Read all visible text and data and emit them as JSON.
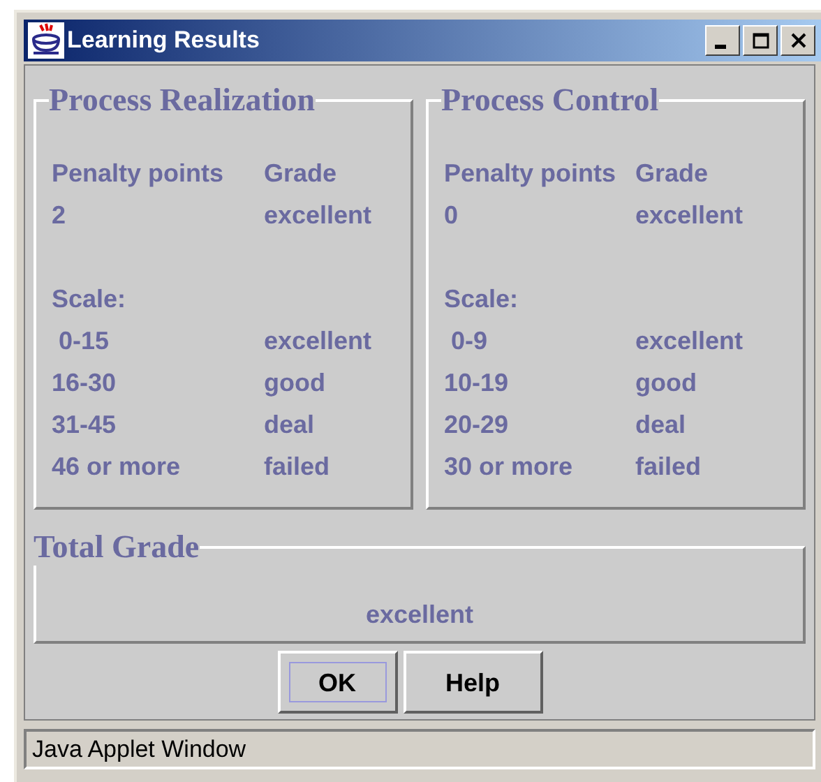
{
  "window": {
    "title": "Learning Results"
  },
  "panels": [
    {
      "title": "Process Realization",
      "header": [
        "Penalty points",
        "Grade"
      ],
      "result": [
        "2",
        "excellent"
      ],
      "scale_label": "Scale:",
      "scale": [
        {
          "range": " 0-15",
          "grade": "excellent"
        },
        {
          "range": "16-30",
          "grade": "good"
        },
        {
          "range": "31-45",
          "grade": "deal"
        },
        {
          "range": "46 or more",
          "grade": "failed"
        }
      ]
    },
    {
      "title": "Process Control",
      "header": [
        "Penalty points",
        "Grade"
      ],
      "result": [
        "0",
        "excellent"
      ],
      "scale_label": "Scale:",
      "scale": [
        {
          "range": " 0-9",
          "grade": "excellent"
        },
        {
          "range": "10-19",
          "grade": "good"
        },
        {
          "range": "20-29",
          "grade": "deal"
        },
        {
          "range": "30 or more",
          "grade": "failed"
        }
      ]
    }
  ],
  "total": {
    "title": "Total Grade",
    "value": "excellent"
  },
  "buttons": [
    {
      "label": "OK",
      "focused": true
    },
    {
      "label": "Help",
      "focused": false
    }
  ],
  "status_bar": "Java Applet Window"
}
